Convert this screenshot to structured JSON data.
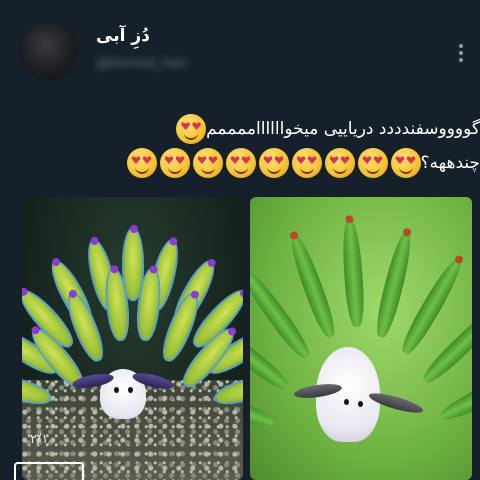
{
  "post": {
    "author": {
      "display_name": "دُزِ آبی",
      "handle": "@blurred_handle"
    },
    "text_line_1": "گووووسفندددد دریاییی میخوااااااممممم",
    "text_line_2": "چندههه؟",
    "emoji_icon": "smiling-face-with-heart-eyes-icon",
    "emoji_count_line_1": 1,
    "emoji_count_line_2": 9
  },
  "media": {
    "images": [
      {
        "subject": "sea slug (leaf sheep) with purple-tipped green cerata on seabed"
      },
      {
        "subject": "sea slug (leaf sheep) with green cerata on green background"
      }
    ],
    "watermark_text": "۲/۱"
  },
  "colors": {
    "background": "#15202b",
    "text": "#ffffff",
    "secondary_text": "#8b98a5",
    "emoji_heart": "#e0304a"
  }
}
